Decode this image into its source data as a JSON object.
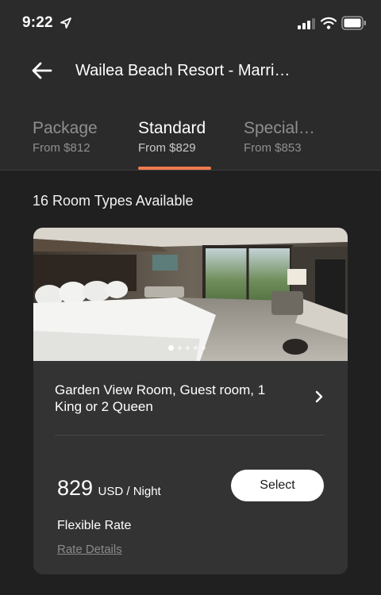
{
  "status_bar": {
    "time": "9:22",
    "icons": [
      "location-arrow-icon",
      "signal-icon",
      "wifi-icon",
      "battery-icon"
    ]
  },
  "header": {
    "back_icon": "arrow-left-icon",
    "title": "Wailea Beach Resort - Marri…"
  },
  "tabs": [
    {
      "name": "Package",
      "price": "From $812",
      "active": false
    },
    {
      "name": "Standard",
      "price": "From $829",
      "active": true
    },
    {
      "name": "Special…",
      "price": "From $853",
      "active": false
    }
  ],
  "rooms_available": "16 Room Types Available",
  "room_card": {
    "photo_count": 5,
    "active_photo": 1,
    "room_name": "Garden View Room, Guest room, 1 King or 2 Queen",
    "price": "829",
    "price_unit": "USD / Night",
    "select_label": "Select",
    "rate_name": "Flexible Rate",
    "rate_details_label": "Rate Details"
  },
  "colors": {
    "background": "#202020",
    "header_background": "#2b2b2b",
    "card_background": "#333333",
    "accent": "#f07a4e"
  }
}
